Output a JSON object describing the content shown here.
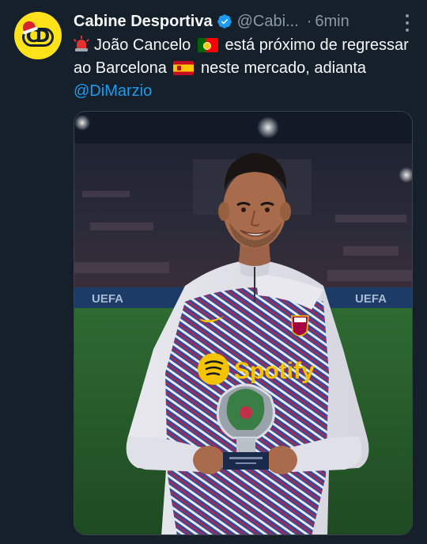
{
  "author": {
    "name": "Cabine Desportiva",
    "handle": "@Cabi...",
    "time": "6min",
    "separator": "·"
  },
  "tweet": {
    "text_part1": "João Cancelo",
    "text_part2": "está próximo de regressar ao Barcelona",
    "text_part3": "neste mercado, adianta",
    "mention": "@DiMarzio"
  },
  "media": {
    "sponsor_text": "Spotify",
    "banner_text_left": "UEFA",
    "banner_text_right": "UEFA"
  },
  "icons": {
    "avatar": "cabine-desportiva-logo",
    "verified": "verified-badge-icon",
    "more": "more-options-icon",
    "siren": "police-light-emoji",
    "flag_portugal": "flag-portugal-emoji",
    "flag_spain": "flag-spain-emoji"
  },
  "colors": {
    "background": "#15202b",
    "text": "#f7f9f9",
    "muted": "#8b98a5",
    "link": "#1d9bf0",
    "verified": "#1d9bf0",
    "avatar_bg": "#ffe21a"
  }
}
